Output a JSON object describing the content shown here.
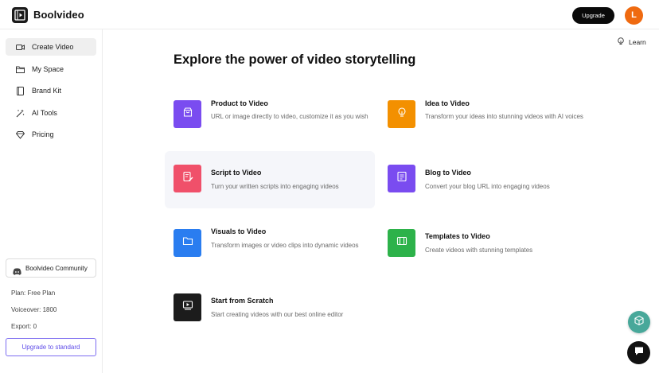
{
  "header": {
    "brand": "Boolvideo",
    "upgrade_label": "Upgrade",
    "avatar_initial": "L",
    "avatar_color": "#ef6a10"
  },
  "sidebar": {
    "items": [
      {
        "label": "Create Video",
        "icon": "video-camera-icon",
        "active": true
      },
      {
        "label": "My Space",
        "icon": "folder-icon",
        "active": false
      },
      {
        "label": "Brand Kit",
        "icon": "book-icon",
        "active": false
      },
      {
        "label": "AI Tools",
        "icon": "magic-wand-icon",
        "active": false
      },
      {
        "label": "Pricing",
        "icon": "diamond-icon",
        "active": false
      }
    ],
    "community_label": "Boolvideo Community",
    "plan": "Plan: Free Plan",
    "voiceover": "Voiceover: 1800",
    "export": "Export: 0",
    "upgrade_standard_label": "Upgrade to standard"
  },
  "learn_label": "Learn",
  "headline": "Explore the power of video storytelling",
  "cards": [
    {
      "title": "Product to Video",
      "desc": "URL or image directly to video, customize it as you wish",
      "icon": "shopping-bag-icon",
      "color": "#7a4cf0"
    },
    {
      "title": "Idea to Video",
      "desc": "Transform your ideas into stunning videos with AI voices",
      "icon": "lightbulb-icon",
      "color": "#f39000"
    },
    {
      "title": "Script to Video",
      "desc": "Turn your written scripts into engaging videos",
      "icon": "script-edit-icon",
      "color": "#f0506a"
    },
    {
      "title": "Blog to Video",
      "desc": "Convert your blog URL into engaging videos",
      "icon": "document-icon",
      "color": "#7a4cf0"
    },
    {
      "title": "Visuals to Video",
      "desc": "Transform images or video clips into dynamic videos",
      "icon": "folder-icon",
      "color": "#2a7df0"
    },
    {
      "title": "Templates to Video",
      "desc": "Create videos with stunning templates",
      "icon": "template-icon",
      "color": "#2db24a"
    },
    {
      "title": "Start from Scratch",
      "desc": "Start creating videos with our best online editor",
      "icon": "editor-monitor-icon",
      "color": "#1c1c1c"
    }
  ]
}
